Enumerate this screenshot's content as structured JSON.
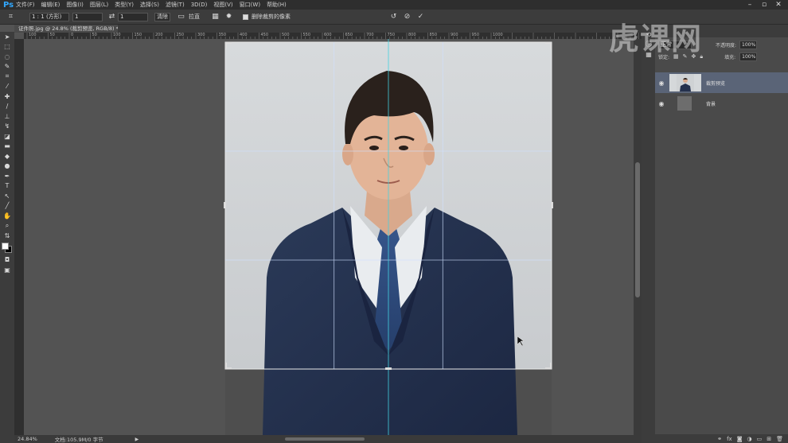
{
  "app": {
    "logo": "Ps"
  },
  "menu": [
    "文件(F)",
    "编辑(E)",
    "图像(I)",
    "图层(L)",
    "类型(Y)",
    "选择(S)",
    "滤镜(T)",
    "3D(D)",
    "视图(V)",
    "窗口(W)",
    "帮助(H)"
  ],
  "options": {
    "ratio_value": "1 : 1 (方形)",
    "width_value": "1",
    "height_value": "1",
    "clear_label": "清除",
    "straighten_label": "拉直",
    "delete_pixels_label": "删除裁剪的像素"
  },
  "document": {
    "tab_title": "证件照.jpg @ 24.8% (裁剪预览, RGB/8) *"
  },
  "status": {
    "zoom": "24.84%",
    "doc_info": "文档:105.9M/0 字节"
  },
  "ruler_labels": [
    "100",
    "50",
    "0",
    "50",
    "100",
    "150",
    "200",
    "250",
    "300",
    "350",
    "400",
    "450",
    "500",
    "550",
    "600",
    "650",
    "700",
    "750",
    "800",
    "850",
    "900",
    "950",
    "1000"
  ],
  "layers": {
    "blend_mode": "正常",
    "opacity_label": "不透明度:",
    "opacity_value": "100%",
    "lock_label": "锁定:",
    "fill_label": "填充:",
    "fill_value": "100%",
    "items": [
      {
        "name": "裁剪预览",
        "selected": true
      },
      {
        "name": "背景",
        "selected": false
      }
    ]
  },
  "watermark": "虎课网",
  "colors": {
    "accent": "#31a8ff",
    "selected_layer": "#5a6477",
    "crop_grid": "#cfe0ff"
  }
}
